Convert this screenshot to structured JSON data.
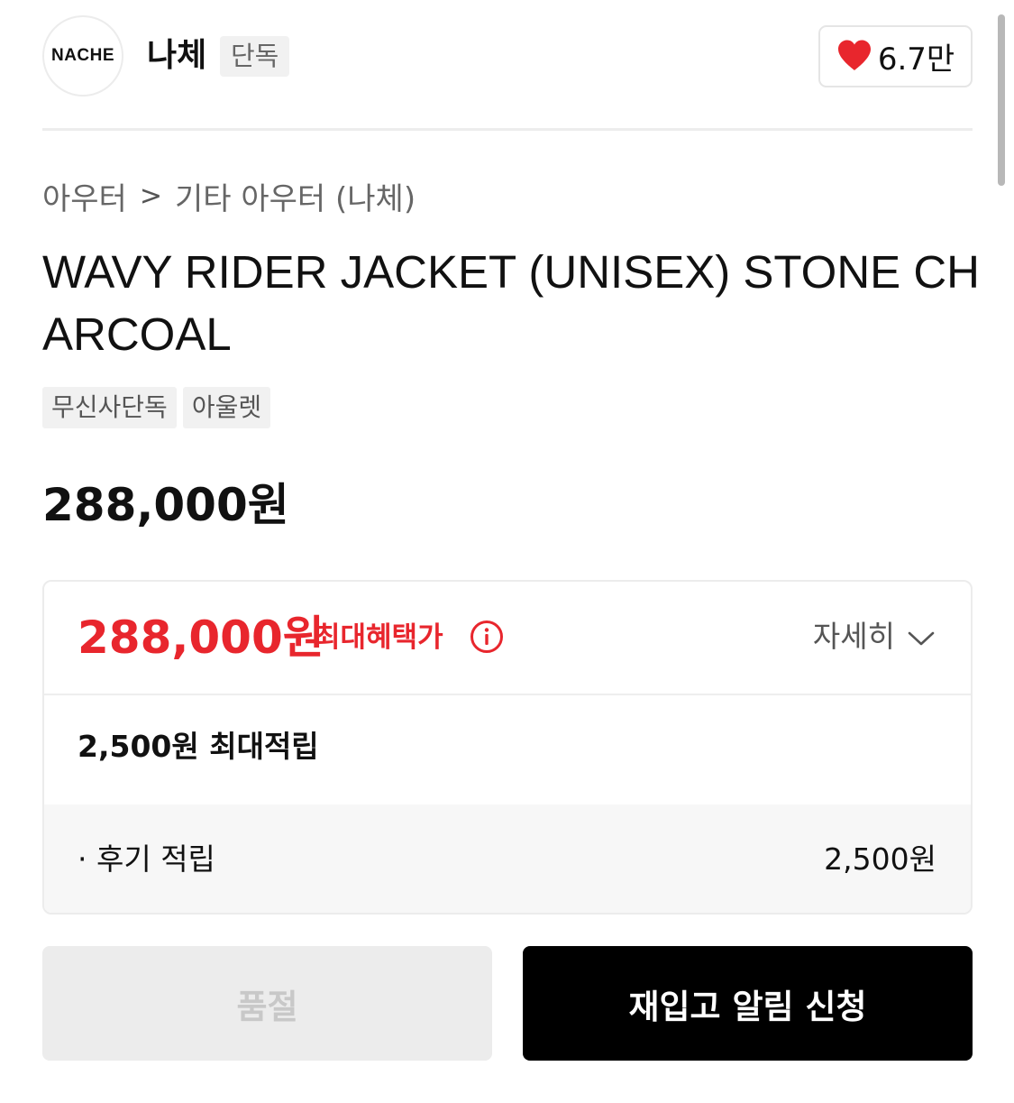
{
  "brand": {
    "logo_text": "NACHE",
    "name": "나체",
    "badge": "단독",
    "like_count": "6.7만",
    "heart_color": "#e8262d"
  },
  "breadcrumb": {
    "items": [
      "아우터",
      "기타 아우터 (나체)"
    ],
    "separator": ">"
  },
  "product": {
    "title": "WAVY RIDER JACKET (UNISEX) STONE CHARCOAL",
    "tags": [
      "무신사단독",
      "아울렛"
    ],
    "price": "288,000원"
  },
  "benefit": {
    "max_price": "288,000원",
    "max_label": "최대혜택가",
    "detail_label": "자세히",
    "reward_summary": "2,500원 최대적립",
    "review_label": "· 후기 적립",
    "review_value": "2,500원",
    "accent_color": "#e8262d"
  },
  "actions": {
    "soldout_label": "품절",
    "restock_label": "재입고 알림 신청"
  },
  "icons": {
    "like": "heart-icon",
    "breadcrumb_separator": "chevron-right-icon",
    "info": "info-icon",
    "detail": "chevron-down-icon"
  }
}
